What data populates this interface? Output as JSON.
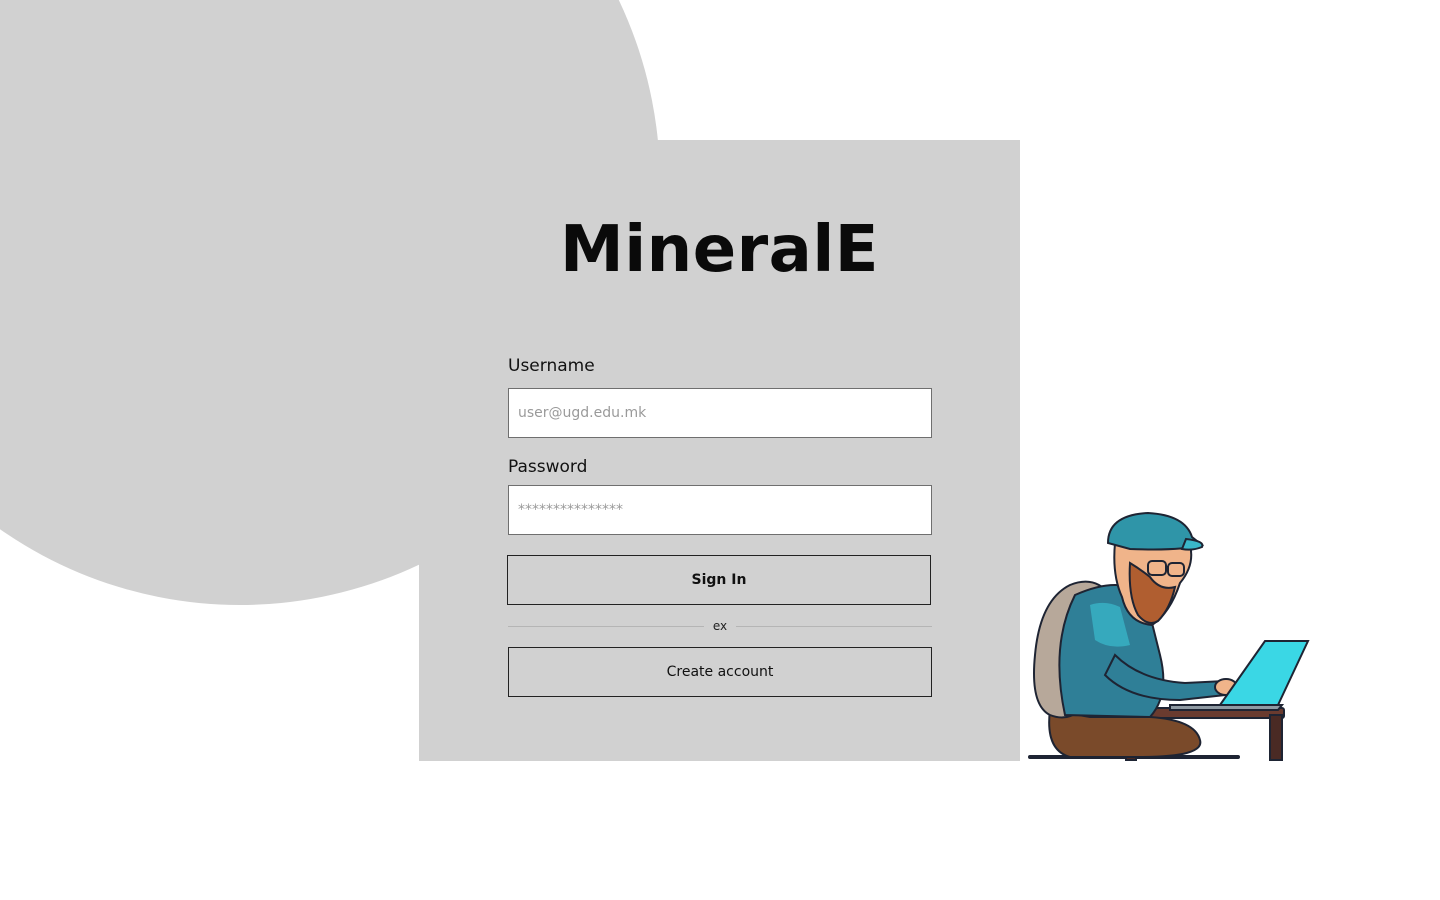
{
  "app": {
    "title": "MineralE"
  },
  "form": {
    "username": {
      "label": "Username",
      "placeholder": "user@ugd.edu.mk",
      "value": ""
    },
    "password": {
      "label": "Password",
      "placeholder": "***************",
      "value": ""
    },
    "signin_label": "Sign In",
    "divider_text": "ex",
    "create_label": "Create account"
  },
  "illustration": {
    "name": "developer-with-laptop-illustration"
  },
  "colors": {
    "panel": "#d1d1d1",
    "background": "#ffffff",
    "text": "#0a0a0a",
    "accent": "#3ab7c9"
  }
}
